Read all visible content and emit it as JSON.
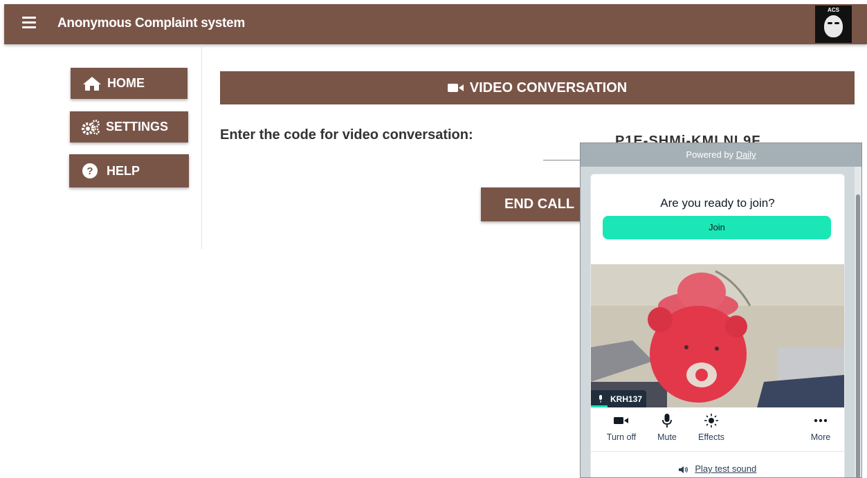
{
  "header": {
    "title": "Anonymous Complaint system",
    "logo_text": "ACS"
  },
  "sidebar": {
    "items": [
      {
        "label": "HOME",
        "icon": "home-icon"
      },
      {
        "label": "SETTINGS",
        "icon": "gears-icon"
      },
      {
        "label": "HELP",
        "icon": "question-circle-icon"
      }
    ]
  },
  "main": {
    "section_title": "VIDEO CONVERSATION",
    "prompt": "Enter the code for video conversation:",
    "code_value": "P1E-SHMi-KMLNL9F",
    "end_call_label": "END CALL"
  },
  "daily": {
    "powered_by": "Powered by",
    "powered_link": "Daily",
    "ready_text": "Are you ready to join?",
    "join_label": "Join",
    "participant_name": "KRH137",
    "controls": [
      {
        "label": "Turn off",
        "icon": "camera-icon"
      },
      {
        "label": "Mute",
        "icon": "microphone-icon"
      },
      {
        "label": "Effects",
        "icon": "effects-icon"
      },
      {
        "label": "More",
        "icon": "more-icon"
      }
    ],
    "test_sound": "Play test sound"
  },
  "colors": {
    "brand": "#795548",
    "join": "#1be7b6",
    "daily_bar": "#a5b0b6"
  }
}
